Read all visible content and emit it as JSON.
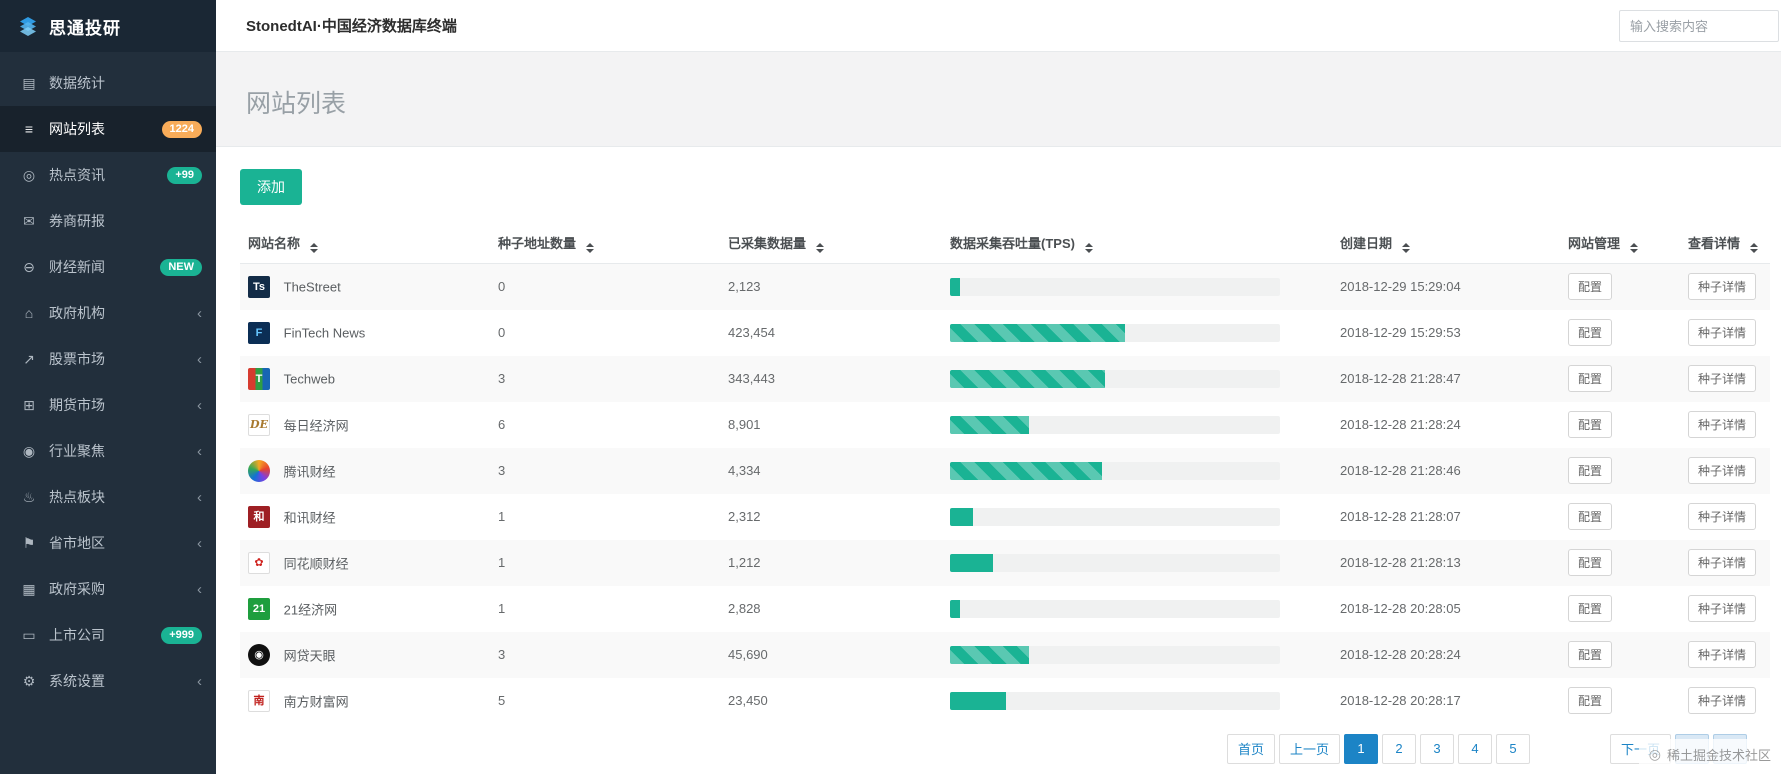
{
  "app": {
    "brand": "思通投研",
    "header_title": "StonedtAI·中国经济数据库终端",
    "search_placeholder": "输入搜索内容"
  },
  "colors": {
    "accent_green": "#1ab394",
    "badge_orange": "#f8ac59",
    "pagination_blue": "#1c84c6",
    "sidebar_bg": "#222f3c"
  },
  "sidebar": {
    "items": [
      {
        "label": "数据统计",
        "icon": "bar-chart-icon"
      },
      {
        "label": "网站列表",
        "icon": "list-icon",
        "active": true,
        "badge": "1224",
        "badge_color": "#f8ac59"
      },
      {
        "label": "热点资讯",
        "icon": "globe-icon",
        "badge": "+99",
        "badge_color": "#1ab394"
      },
      {
        "label": "券商研报",
        "icon": "envelope-icon"
      },
      {
        "label": "财经新闻",
        "icon": "news-icon",
        "badge": "NEW",
        "badge_color": "#1ab394"
      },
      {
        "label": "政府机构",
        "icon": "bank-icon",
        "chevron": true
      },
      {
        "label": "股票市场",
        "icon": "stock-chart-icon",
        "chevron": true
      },
      {
        "label": "期货市场",
        "icon": "futures-icon",
        "chevron": true
      },
      {
        "label": "行业聚焦",
        "icon": "industry-icon",
        "chevron": true
      },
      {
        "label": "热点板块",
        "icon": "hot-sector-icon",
        "chevron": true
      },
      {
        "label": "省市地区",
        "icon": "region-flag-icon",
        "chevron": true
      },
      {
        "label": "政府采购",
        "icon": "procurement-icon",
        "chevron": true
      },
      {
        "label": "上市公司",
        "icon": "listed-company-icon",
        "badge": "+999",
        "badge_color": "#1ab394"
      },
      {
        "label": "系统设置",
        "icon": "gear-icon",
        "chevron": true
      }
    ]
  },
  "page": {
    "title": "网站列表",
    "add_button": "添加"
  },
  "table": {
    "columns": [
      {
        "label": "网站名称"
      },
      {
        "label": "种子地址数量"
      },
      {
        "label": "已采集数据量"
      },
      {
        "label": "数据采集吞吐量(TPS)"
      },
      {
        "label": "创建日期"
      },
      {
        "label": "网站管理"
      },
      {
        "label": "查看详情"
      }
    ],
    "actions": {
      "manage": "配置",
      "detail": "种子详情"
    },
    "rows": [
      {
        "name": "TheStreet",
        "seeds": "0",
        "collected": "2,123",
        "tps_percent": 3,
        "striped": false,
        "created": "2018-12-29 15:29:04",
        "favicon": {
          "text": "Ts",
          "bg": "#132c47",
          "color": "#ffffff"
        }
      },
      {
        "name": "FinTech News",
        "seeds": "0",
        "collected": "423,454",
        "tps_percent": 53,
        "striped": true,
        "created": "2018-12-29 15:29:53",
        "favicon": {
          "text": "F",
          "bg": "#0b2e55",
          "color": "#66c6ff"
        }
      },
      {
        "name": "Techweb",
        "seeds": "3",
        "collected": "343,443",
        "tps_percent": 47,
        "striped": true,
        "created": "2018-12-28 21:28:47",
        "favicon": {
          "text": "T",
          "bg": "linear-gradient(90deg,#d63b2f 0 34%,#2f9e44 34% 67%,#1766b3 67%)",
          "color": "#ffffff"
        }
      },
      {
        "name": "每日经济网",
        "seeds": "6",
        "collected": "8,901",
        "tps_percent": 24,
        "striped": true,
        "created": "2018-12-28 21:28:24",
        "favicon": {
          "text": "DE",
          "bg": "#ffffff",
          "color": "#a8792f",
          "border": true,
          "serif": true
        }
      },
      {
        "name": "腾讯财经",
        "seeds": "3",
        "collected": "4,334",
        "tps_percent": 46,
        "striped": true,
        "created": "2018-12-28 21:28:46",
        "favicon": {
          "text": "",
          "bg": "conic-gradient(#f5a623,#e8432d,#7b3fe4,#1271d6,#35a854,#f5a623)",
          "round": true
        }
      },
      {
        "name": "和讯财经",
        "seeds": "1",
        "collected": "2,312",
        "tps_percent": 7,
        "striped": false,
        "created": "2018-12-28 21:28:07",
        "favicon": {
          "text": "和",
          "bg": "#9e1f24",
          "color": "#ffffff"
        }
      },
      {
        "name": "同花顺财经",
        "seeds": "1",
        "collected": "1,212",
        "tps_percent": 13,
        "striped": false,
        "created": "2018-12-28 21:28:13",
        "favicon": {
          "text": "✿",
          "bg": "#ffffff",
          "color": "#d0231f",
          "border": true
        }
      },
      {
        "name": "21经济网",
        "seeds": "1",
        "collected": "2,828",
        "tps_percent": 3,
        "striped": false,
        "created": "2018-12-28 20:28:05",
        "favicon": {
          "text": "21",
          "bg": "#1e9e3e",
          "color": "#ffffff"
        }
      },
      {
        "name": "网贷天眼",
        "seeds": "3",
        "collected": "45,690",
        "tps_percent": 24,
        "striped": true,
        "created": "2018-12-28 20:28:24",
        "favicon": {
          "text": "◉",
          "bg": "#101010",
          "color": "#ffffff",
          "round": true
        }
      },
      {
        "name": "南方财富网",
        "seeds": "5",
        "collected": "23,450",
        "tps_percent": 17,
        "striped": false,
        "created": "2018-12-28 20:28:17",
        "favicon": {
          "text": "南",
          "bg": "#ffffff",
          "color": "#c0201d",
          "border": true
        }
      }
    ]
  },
  "pagination": {
    "first": "首页",
    "prev": "上一页",
    "pages": [
      {
        "label": "1",
        "active": true
      },
      {
        "label": "2"
      },
      {
        "label": "3"
      },
      {
        "label": "4"
      },
      {
        "label": "5"
      }
    ],
    "next": "下一页"
  },
  "watermark": {
    "text": "稀土掘金技术社区"
  }
}
